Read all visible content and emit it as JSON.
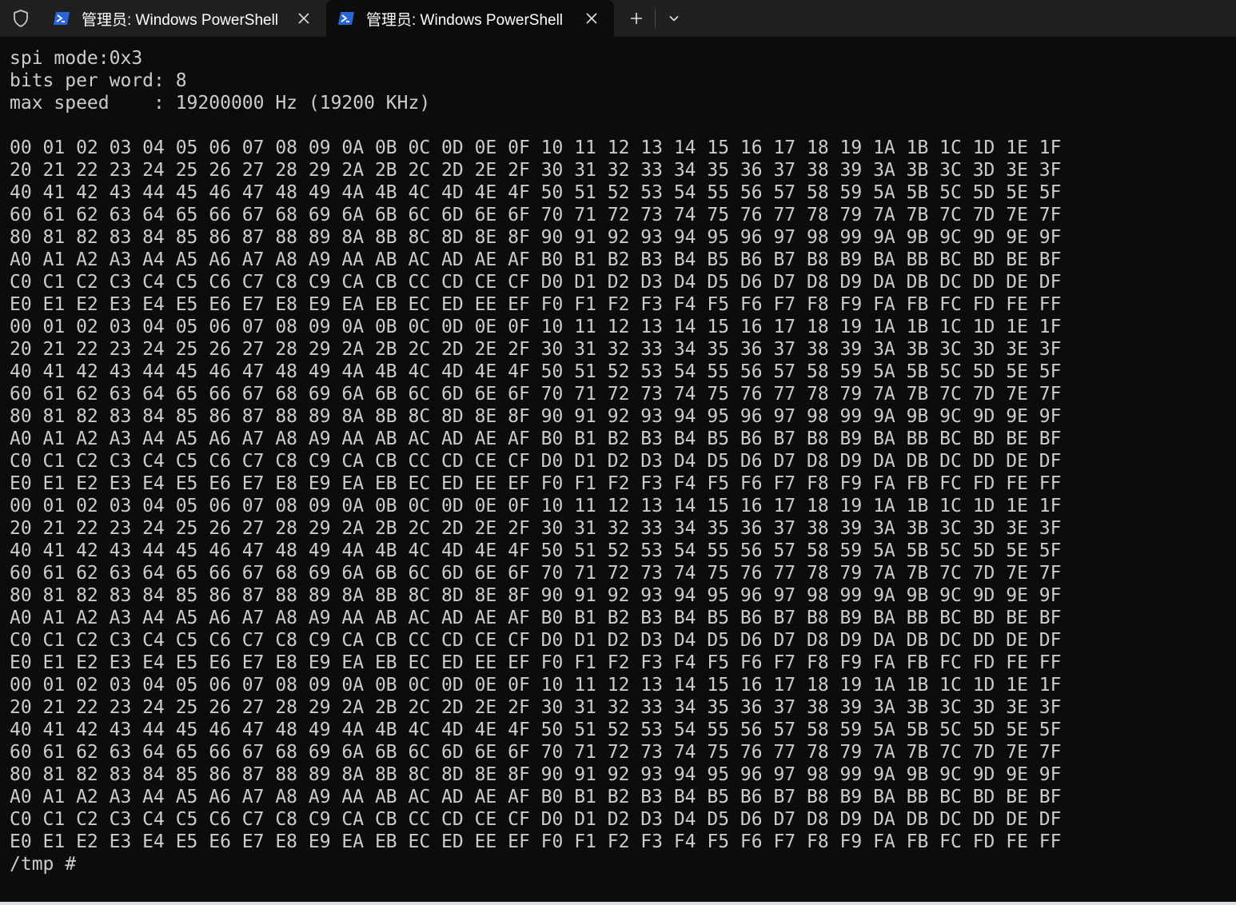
{
  "tabs": [
    {
      "title": "管理员: Windows PowerShell",
      "active": false
    },
    {
      "title": "管理员: Windows PowerShell",
      "active": true
    }
  ],
  "actions": {
    "new_tab": "+",
    "dropdown": "⌄"
  },
  "colors": {
    "tabbar_bg": "#202020",
    "terminal_bg": "#0c0c0c",
    "text": "#cccccc",
    "powershell_icon": "#2b66d8"
  },
  "terminal": {
    "lines": [
      "spi mode:0x3",
      "bits per word: 8",
      "max speed    : 19200000 Hz (19200 KHz)",
      "",
      "00 01 02 03 04 05 06 07 08 09 0A 0B 0C 0D 0E 0F 10 11 12 13 14 15 16 17 18 19 1A 1B 1C 1D 1E 1F",
      "20 21 22 23 24 25 26 27 28 29 2A 2B 2C 2D 2E 2F 30 31 32 33 34 35 36 37 38 39 3A 3B 3C 3D 3E 3F",
      "40 41 42 43 44 45 46 47 48 49 4A 4B 4C 4D 4E 4F 50 51 52 53 54 55 56 57 58 59 5A 5B 5C 5D 5E 5F",
      "60 61 62 63 64 65 66 67 68 69 6A 6B 6C 6D 6E 6F 70 71 72 73 74 75 76 77 78 79 7A 7B 7C 7D 7E 7F",
      "80 81 82 83 84 85 86 87 88 89 8A 8B 8C 8D 8E 8F 90 91 92 93 94 95 96 97 98 99 9A 9B 9C 9D 9E 9F",
      "A0 A1 A2 A3 A4 A5 A6 A7 A8 A9 AA AB AC AD AE AF B0 B1 B2 B3 B4 B5 B6 B7 B8 B9 BA BB BC BD BE BF",
      "C0 C1 C2 C3 C4 C5 C6 C7 C8 C9 CA CB CC CD CE CF D0 D1 D2 D3 D4 D5 D6 D7 D8 D9 DA DB DC DD DE DF",
      "E0 E1 E2 E3 E4 E5 E6 E7 E8 E9 EA EB EC ED EE EF F0 F1 F2 F3 F4 F5 F6 F7 F8 F9 FA FB FC FD FE FF",
      "00 01 02 03 04 05 06 07 08 09 0A 0B 0C 0D 0E 0F 10 11 12 13 14 15 16 17 18 19 1A 1B 1C 1D 1E 1F",
      "20 21 22 23 24 25 26 27 28 29 2A 2B 2C 2D 2E 2F 30 31 32 33 34 35 36 37 38 39 3A 3B 3C 3D 3E 3F",
      "40 41 42 43 44 45 46 47 48 49 4A 4B 4C 4D 4E 4F 50 51 52 53 54 55 56 57 58 59 5A 5B 5C 5D 5E 5F",
      "60 61 62 63 64 65 66 67 68 69 6A 6B 6C 6D 6E 6F 70 71 72 73 74 75 76 77 78 79 7A 7B 7C 7D 7E 7F",
      "80 81 82 83 84 85 86 87 88 89 8A 8B 8C 8D 8E 8F 90 91 92 93 94 95 96 97 98 99 9A 9B 9C 9D 9E 9F",
      "A0 A1 A2 A3 A4 A5 A6 A7 A8 A9 AA AB AC AD AE AF B0 B1 B2 B3 B4 B5 B6 B7 B8 B9 BA BB BC BD BE BF",
      "C0 C1 C2 C3 C4 C5 C6 C7 C8 C9 CA CB CC CD CE CF D0 D1 D2 D3 D4 D5 D6 D7 D8 D9 DA DB DC DD DE DF",
      "E0 E1 E2 E3 E4 E5 E6 E7 E8 E9 EA EB EC ED EE EF F0 F1 F2 F3 F4 F5 F6 F7 F8 F9 FA FB FC FD FE FF",
      "00 01 02 03 04 05 06 07 08 09 0A 0B 0C 0D 0E 0F 10 11 12 13 14 15 16 17 18 19 1A 1B 1C 1D 1E 1F",
      "20 21 22 23 24 25 26 27 28 29 2A 2B 2C 2D 2E 2F 30 31 32 33 34 35 36 37 38 39 3A 3B 3C 3D 3E 3F",
      "40 41 42 43 44 45 46 47 48 49 4A 4B 4C 4D 4E 4F 50 51 52 53 54 55 56 57 58 59 5A 5B 5C 5D 5E 5F",
      "60 61 62 63 64 65 66 67 68 69 6A 6B 6C 6D 6E 6F 70 71 72 73 74 75 76 77 78 79 7A 7B 7C 7D 7E 7F",
      "80 81 82 83 84 85 86 87 88 89 8A 8B 8C 8D 8E 8F 90 91 92 93 94 95 96 97 98 99 9A 9B 9C 9D 9E 9F",
      "A0 A1 A2 A3 A4 A5 A6 A7 A8 A9 AA AB AC AD AE AF B0 B1 B2 B3 B4 B5 B6 B7 B8 B9 BA BB BC BD BE BF",
      "C0 C1 C2 C3 C4 C5 C6 C7 C8 C9 CA CB CC CD CE CF D0 D1 D2 D3 D4 D5 D6 D7 D8 D9 DA DB DC DD DE DF",
      "E0 E1 E2 E3 E4 E5 E6 E7 E8 E9 EA EB EC ED EE EF F0 F1 F2 F3 F4 F5 F6 F7 F8 F9 FA FB FC FD FE FF",
      "00 01 02 03 04 05 06 07 08 09 0A 0B 0C 0D 0E 0F 10 11 12 13 14 15 16 17 18 19 1A 1B 1C 1D 1E 1F",
      "20 21 22 23 24 25 26 27 28 29 2A 2B 2C 2D 2E 2F 30 31 32 33 34 35 36 37 38 39 3A 3B 3C 3D 3E 3F",
      "40 41 42 43 44 45 46 47 48 49 4A 4B 4C 4D 4E 4F 50 51 52 53 54 55 56 57 58 59 5A 5B 5C 5D 5E 5F",
      "60 61 62 63 64 65 66 67 68 69 6A 6B 6C 6D 6E 6F 70 71 72 73 74 75 76 77 78 79 7A 7B 7C 7D 7E 7F",
      "80 81 82 83 84 85 86 87 88 89 8A 8B 8C 8D 8E 8F 90 91 92 93 94 95 96 97 98 99 9A 9B 9C 9D 9E 9F",
      "A0 A1 A2 A3 A4 A5 A6 A7 A8 A9 AA AB AC AD AE AF B0 B1 B2 B3 B4 B5 B6 B7 B8 B9 BA BB BC BD BE BF",
      "C0 C1 C2 C3 C4 C5 C6 C7 C8 C9 CA CB CC CD CE CF D0 D1 D2 D3 D4 D5 D6 D7 D8 D9 DA DB DC DD DE DF",
      "E0 E1 E2 E3 E4 E5 E6 E7 E8 E9 EA EB EC ED EE EF F0 F1 F2 F3 F4 F5 F6 F7 F8 F9 FA FB FC FD FE FF",
      "/tmp # "
    ]
  }
}
